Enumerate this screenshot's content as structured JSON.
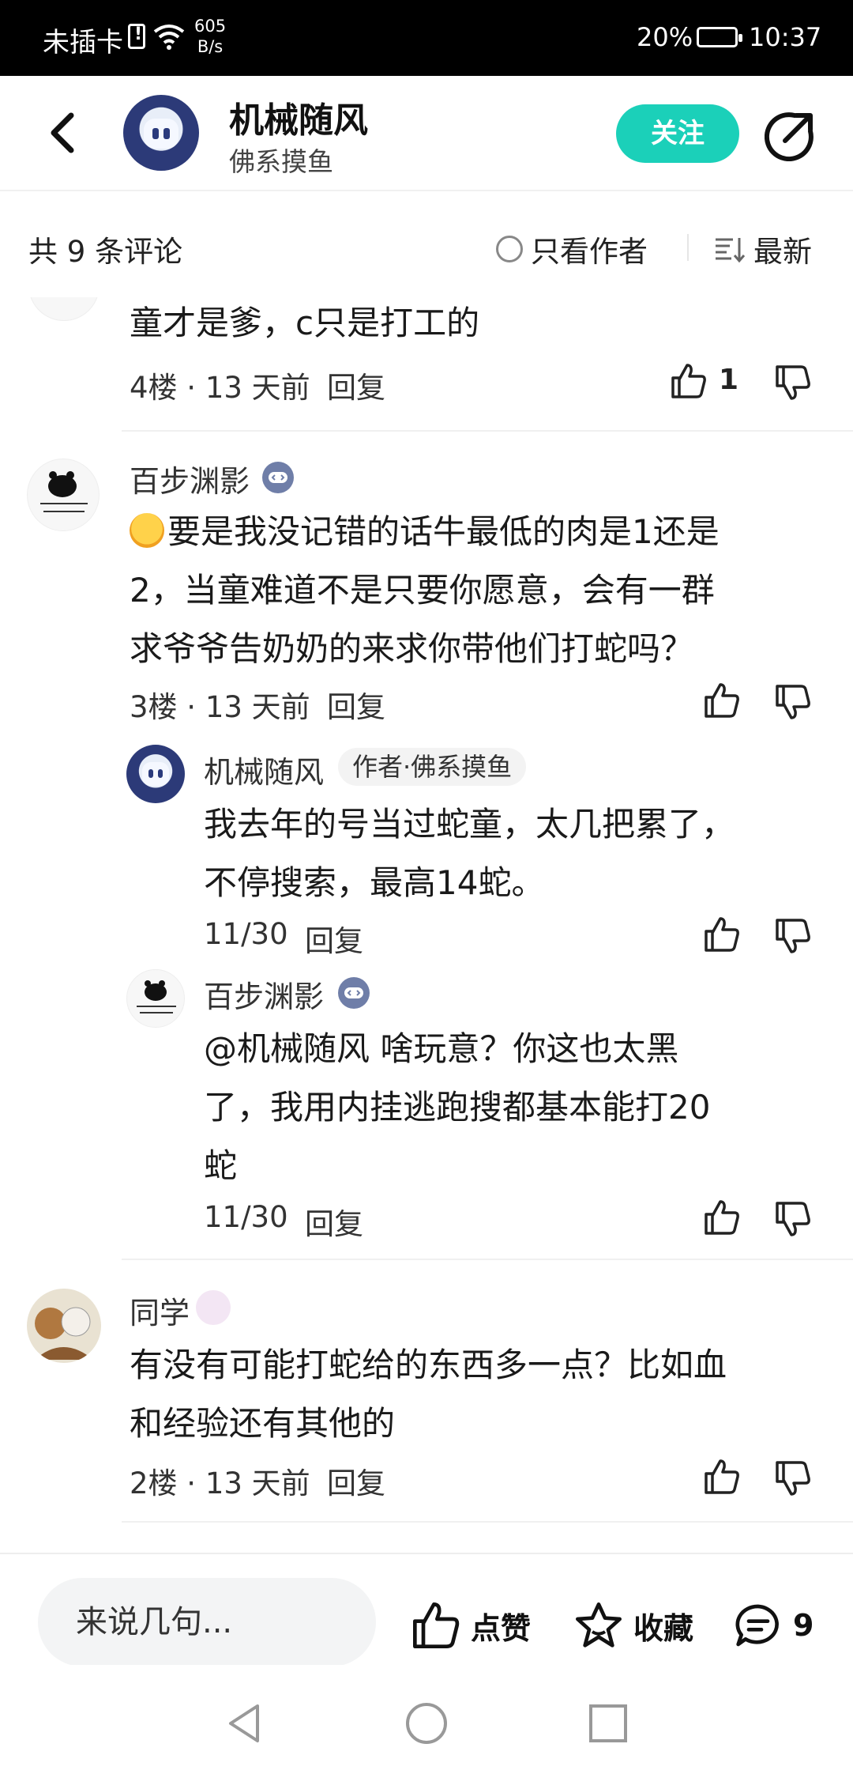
{
  "status_bar": {
    "carrier": "未插卡",
    "net_speed_value": "605",
    "net_speed_unit": "B/s",
    "battery": "20%",
    "time": "10:37"
  },
  "header": {
    "author_name": "机械随风",
    "author_subtitle": "佛系摸鱼",
    "follow_label": "关注"
  },
  "sort_bar": {
    "count_label": "共 9 条评论",
    "author_only_label": "只看作者",
    "sort_label": "最新"
  },
  "comments": [
    {
      "text": "童才是爹，c只是打工的",
      "meta": "4楼 · 13 天前",
      "reply_label": "回复",
      "likes": "1"
    },
    {
      "user": "百步渊影",
      "lines": [
        "要是我没记错的话牛最低的肉是1还是",
        "2，当童难道不是只要你愿意，会有一群",
        "求爷爷告奶奶的来求你带他们打蛇吗？"
      ],
      "meta": "3楼 · 13 天前",
      "reply_label": "回复",
      "replies": [
        {
          "user": "机械随风",
          "tag": "作者·佛系摸鱼",
          "lines": [
            "我去年的号当过蛇童，太几把累了，",
            "不停搜索，最高14蛇。"
          ],
          "date": "11/30",
          "reply_label": "回复"
        },
        {
          "user": "百步渊影",
          "lines": [
            "@机械随风  啥玩意？你这也太黑",
            "了，我用内挂逃跑搜都基本能打20",
            "蛇"
          ],
          "date": "11/30",
          "reply_label": "回复"
        }
      ]
    },
    {
      "user": "同学",
      "lines": [
        "有没有可能打蛇给的东西多一点？比如血",
        "和经验还有其他的"
      ],
      "meta": "2楼 · 13 天前",
      "reply_label": "回复"
    }
  ],
  "bottom_bar": {
    "input_placeholder": "来说几句...",
    "like_label": "点赞",
    "favorite_label": "收藏",
    "comment_count": "9"
  },
  "colors": {
    "accent": "#1bd0b9",
    "status_bar_bg": "#000000"
  }
}
